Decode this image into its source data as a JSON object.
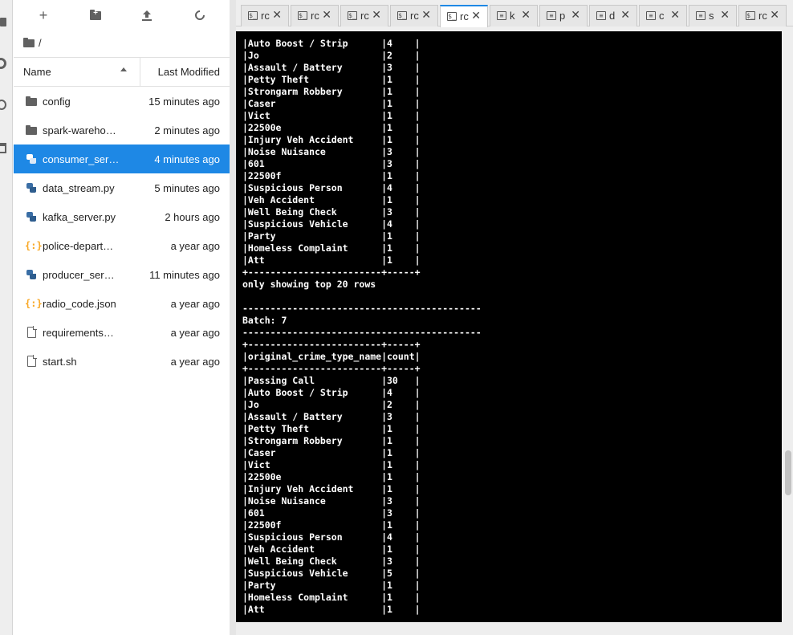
{
  "toolbar": {
    "new_label": "+",
    "new_folder_icon": "new-folder-icon",
    "upload_icon": "upload-icon",
    "refresh_icon": "refresh-icon"
  },
  "breadcrumb": {
    "path": "/"
  },
  "file_header": {
    "name_label": "Name",
    "modified_label": "Last Modified"
  },
  "files": [
    {
      "name": "config",
      "modified": "15 minutes ago",
      "icon": "folder-icon"
    },
    {
      "name": "spark-wareho…",
      "modified": "2 minutes ago",
      "icon": "folder-icon"
    },
    {
      "name": "consumer_ser…",
      "modified": "4 minutes ago",
      "icon": "python-icon"
    },
    {
      "name": "data_stream.py",
      "modified": "5 minutes ago",
      "icon": "python-icon"
    },
    {
      "name": "kafka_server.py",
      "modified": "2 hours ago",
      "icon": "python-icon"
    },
    {
      "name": "police-depart…",
      "modified": "a year ago",
      "icon": "json-icon"
    },
    {
      "name": "producer_ser…",
      "modified": "11 minutes ago",
      "icon": "python-icon"
    },
    {
      "name": "radio_code.json",
      "modified": "a year ago",
      "icon": "json-icon"
    },
    {
      "name": "requirements…",
      "modified": "a year ago",
      "icon": "file-icon"
    },
    {
      "name": "start.sh",
      "modified": "a year ago",
      "icon": "file-icon"
    }
  ],
  "tabs": [
    {
      "label": "rc",
      "icon": "terminal-icon"
    },
    {
      "label": "rc",
      "icon": "terminal-icon"
    },
    {
      "label": "rc",
      "icon": "terminal-icon"
    },
    {
      "label": "rc",
      "icon": "terminal-icon"
    },
    {
      "label": "rc",
      "icon": "terminal-icon"
    },
    {
      "label": "k",
      "icon": "text-file-icon"
    },
    {
      "label": "p",
      "icon": "text-file-icon"
    },
    {
      "label": "d",
      "icon": "text-file-icon"
    },
    {
      "label": "c",
      "icon": "text-file-icon"
    },
    {
      "label": "s",
      "icon": "text-file-icon"
    },
    {
      "label": "rc",
      "icon": "terminal-icon"
    }
  ],
  "terminal": {
    "lines": [
      "|Auto Boost / Strip      |4    |",
      "|Jo                      |2    |",
      "|Assault / Battery       |3    |",
      "|Petty Theft             |1    |",
      "|Strongarm Robbery       |1    |",
      "|Caser                   |1    |",
      "|Vict                    |1    |",
      "|22500e                  |1    |",
      "|Injury Veh Accident     |1    |",
      "|Noise Nuisance          |3    |",
      "|601                     |3    |",
      "|22500f                  |1    |",
      "|Suspicious Person       |4    |",
      "|Veh Accident            |1    |",
      "|Well Being Check        |3    |",
      "|Suspicious Vehicle      |4    |",
      "|Party                   |1    |",
      "|Homeless Complaint      |1    |",
      "|Att                     |1    |",
      "+------------------------+-----+",
      "only showing top 20 rows",
      "",
      "-------------------------------------------",
      "Batch: 7",
      "-------------------------------------------",
      "+------------------------+-----+",
      "|original_crime_type_name|count|",
      "+------------------------+-----+",
      "|Passing Call            |30   |",
      "|Auto Boost / Strip      |4    |",
      "|Jo                      |2    |",
      "|Assault / Battery       |3    |",
      "|Petty Theft             |1    |",
      "|Strongarm Robbery       |1    |",
      "|Caser                   |1    |",
      "|Vict                    |1    |",
      "|22500e                  |1    |",
      "|Injury Veh Accident     |1    |",
      "|Noise Nuisance          |3    |",
      "|601                     |3    |",
      "|22500f                  |1    |",
      "|Suspicious Person       |4    |",
      "|Veh Accident            |1    |",
      "|Well Being Check        |3    |",
      "|Suspicious Vehicle      |5    |",
      "|Party                   |1    |",
      "|Homeless Complaint      |1    |",
      "|Att                     |1    |"
    ]
  },
  "colors": {
    "accent": "#1e88e5",
    "terminal_bg": "#000000",
    "terminal_fg": "#ffffff",
    "json_icon": "#f9a825"
  }
}
